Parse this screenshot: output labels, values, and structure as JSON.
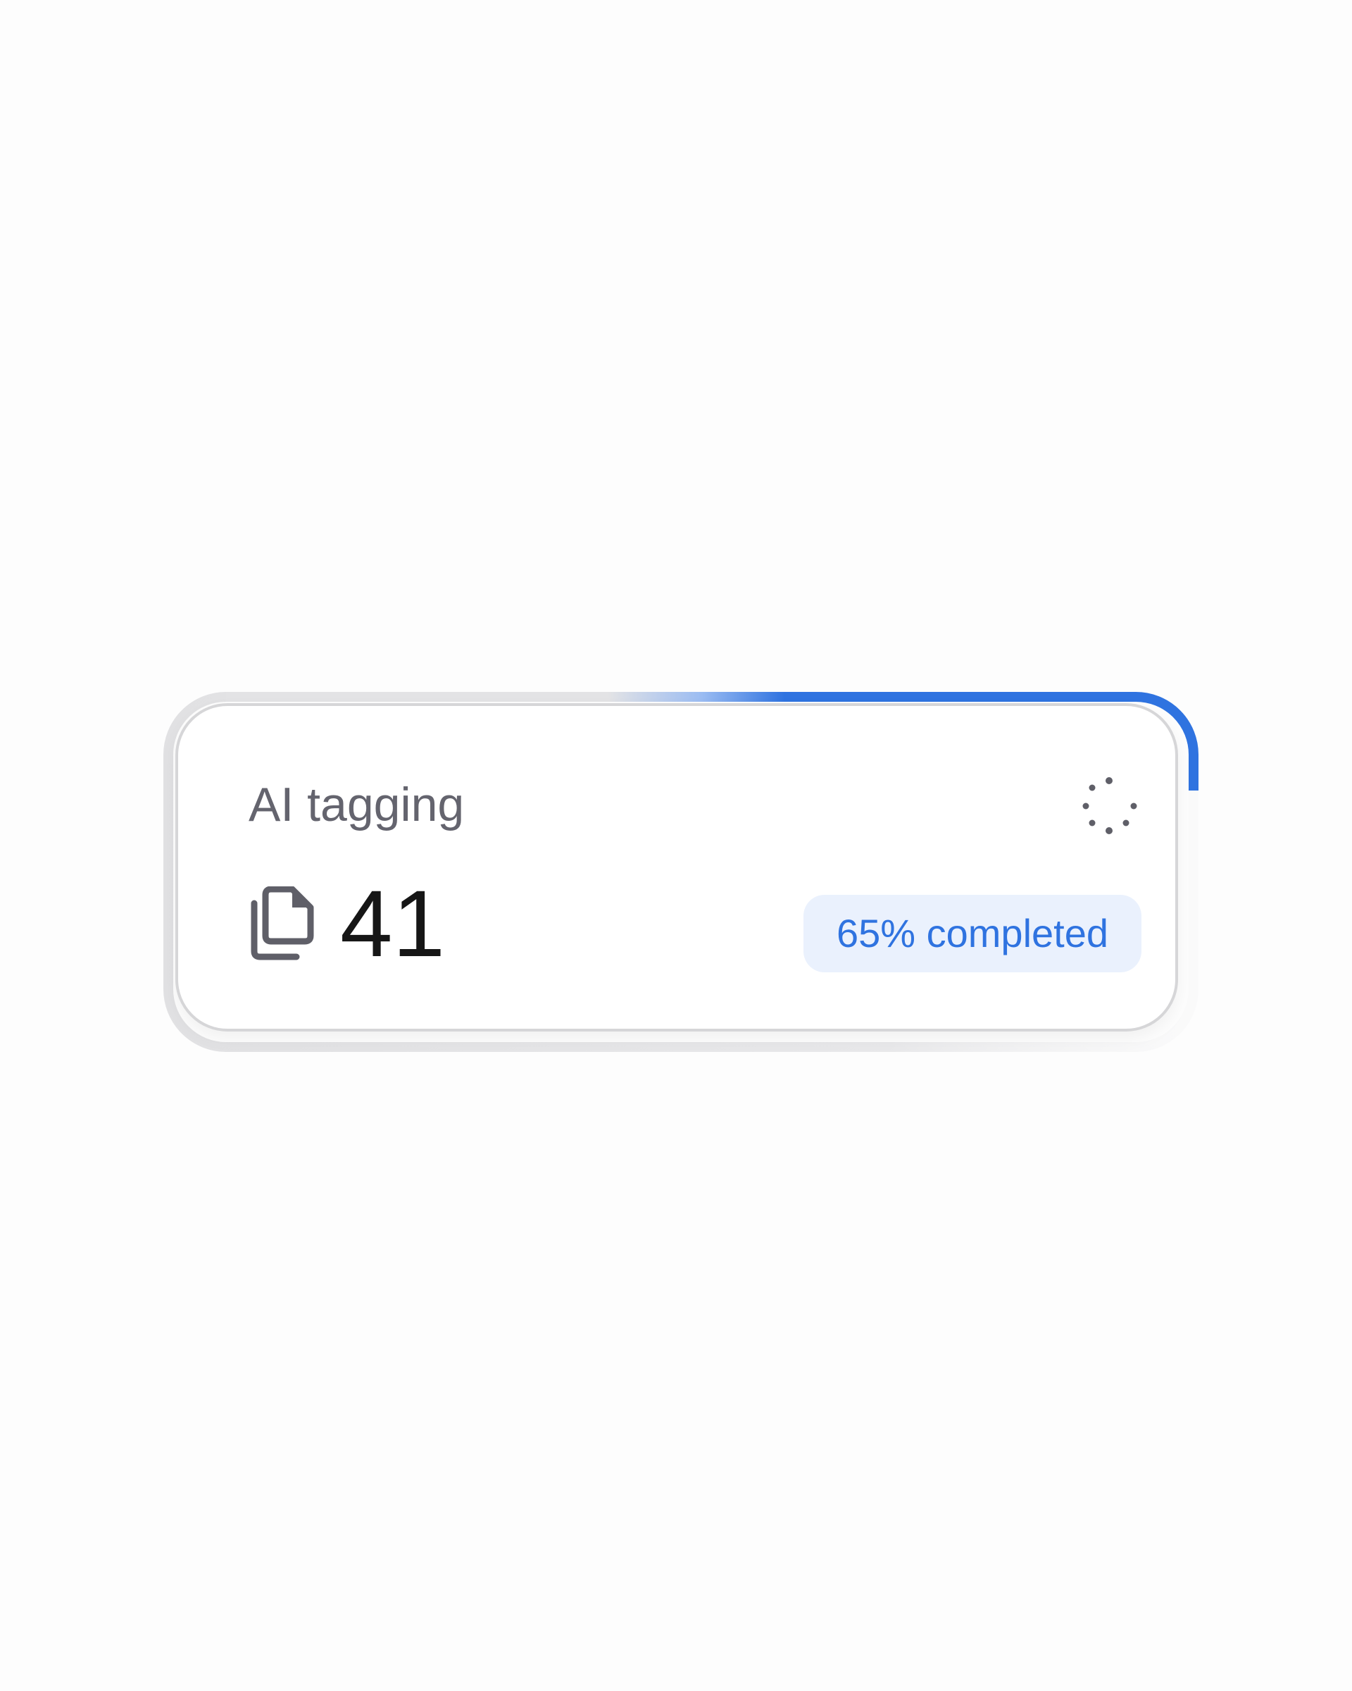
{
  "card": {
    "title": "AI tagging",
    "count": "41",
    "status": "65% completed",
    "progress_percent": 65
  },
  "icons": {
    "document": "documents-copy-icon",
    "spinner": "loading-spinner-icon"
  },
  "colors": {
    "accent": "#2f73e0",
    "badge_bg": "#eaf1fd",
    "title_text": "#64646e",
    "count_text": "#161616",
    "frame_gray": "#e2e2e4",
    "icon_gray": "#5f5f68"
  }
}
